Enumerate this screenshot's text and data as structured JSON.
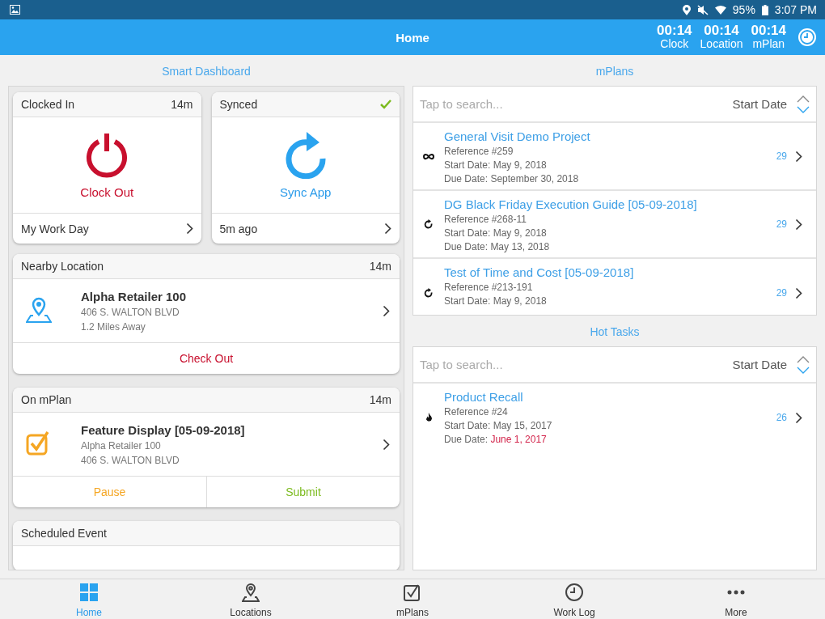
{
  "status_bar": {
    "battery": "95%",
    "time": "3:07 PM"
  },
  "header": {
    "title": "Home",
    "timers": [
      {
        "value": "00:14",
        "label": "Clock"
      },
      {
        "value": "00:14",
        "label": "Location"
      },
      {
        "value": "00:14",
        "label": "mPlan"
      }
    ]
  },
  "dashboard": {
    "title": "Smart Dashboard",
    "clock_card": {
      "title": "Clocked In",
      "duration": "14m",
      "action": "Clock Out",
      "footer": "My Work Day"
    },
    "sync_card": {
      "title": "Synced",
      "synced": true,
      "action": "Sync App",
      "footer": "5m ago"
    },
    "location_card": {
      "title": "Nearby Location",
      "duration": "14m",
      "name": "Alpha Retailer 100",
      "address": "406 S. WALTON BLVD",
      "distance": "1.2 Miles Away",
      "action": "Check Out"
    },
    "mplan_card": {
      "title": "On mPlan",
      "duration": "14m",
      "name": "Feature Display [05-09-2018]",
      "location": "Alpha Retailer 100",
      "address": "406 S. WALTON BLVD",
      "actions": [
        {
          "kind": "pause",
          "label": "Pause"
        },
        {
          "kind": "submit",
          "label": "Submit"
        }
      ]
    },
    "event_card": {
      "title": "Scheduled Event"
    }
  },
  "mplans": {
    "title": "mPlans",
    "search": {
      "placeholder": "Tap to search..."
    },
    "sort": {
      "label": "Start Date",
      "descending": true
    },
    "items": [
      {
        "kind": "infinity",
        "title": "General Visit Demo Project",
        "reference": "Reference #259",
        "start_date": "Start Date: May 9, 2018",
        "due_label": "Due Date:",
        "due_value": "September 30, 2018",
        "overdue": false,
        "count": "29"
      },
      {
        "kind": "repeat",
        "title": "DG Black Friday Execution Guide [05-09-2018]",
        "reference": "Reference #268-11",
        "start_date": "Start Date: May 9, 2018",
        "due_label": "Due Date:",
        "due_value": "May 13, 2018",
        "overdue": false,
        "count": "29"
      },
      {
        "kind": "repeat",
        "title": "Test of Time and Cost [05-09-2018]",
        "reference": "Reference #213-191",
        "start_date": "Start Date: May 9, 2018",
        "count": "29"
      }
    ]
  },
  "hot_tasks": {
    "title": "Hot Tasks",
    "search": {
      "placeholder": "Tap to search..."
    },
    "sort": {
      "label": "Start Date",
      "descending": true
    },
    "items": [
      {
        "kind": "flame",
        "title": "Product Recall",
        "reference": "Reference #24",
        "start_date": "Start Date: May 15, 2017",
        "due_label": "Due Date:",
        "due_value": "June 1, 2017",
        "overdue": true,
        "count": "26"
      }
    ]
  },
  "bottom_nav": [
    {
      "kind": "grid",
      "label": "Home",
      "selected": true
    },
    {
      "kind": "pin",
      "label": "Locations",
      "selected": false
    },
    {
      "kind": "checkbox",
      "label": "mPlans",
      "selected": false
    },
    {
      "kind": "clock",
      "label": "Work Log",
      "selected": false
    },
    {
      "kind": "dots",
      "label": "More",
      "selected": false
    }
  ]
}
